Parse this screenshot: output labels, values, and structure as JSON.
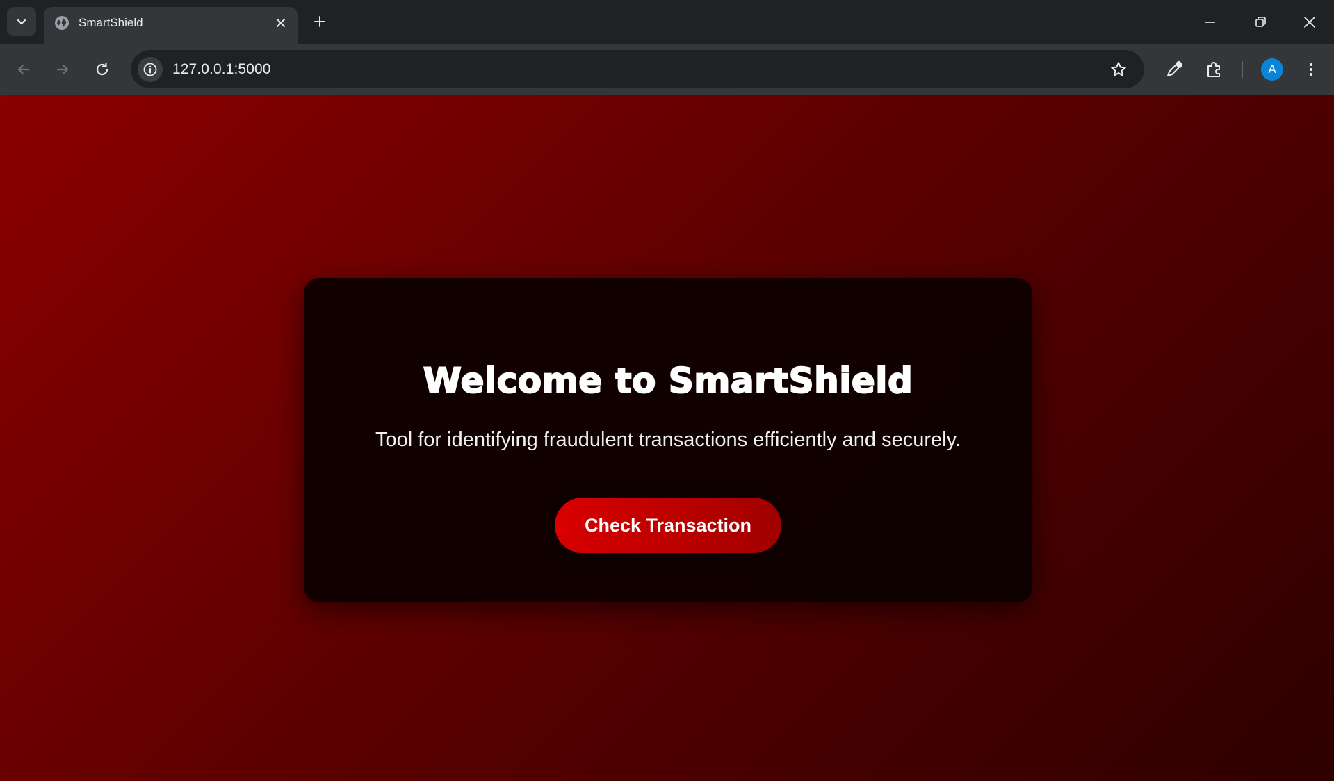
{
  "browser": {
    "tab": {
      "title": "SmartShield",
      "favicon": "globe-icon"
    },
    "address_bar": {
      "url": "127.0.0.1:5000"
    },
    "profile_initial": "A",
    "colors": {
      "chrome_dark": "#202124",
      "chrome_toolbar": "#35363a",
      "profile_blue": "#0b84d8"
    }
  },
  "page": {
    "title": "Welcome to SmartShield",
    "subtitle": "Tool for identifying fraudulent transactions efficiently and securely.",
    "cta_label": "Check Transaction",
    "colors": {
      "background_from": "#8b0000",
      "background_to": "#2d0000",
      "card": "#0c0000",
      "button": "#d90000"
    }
  }
}
